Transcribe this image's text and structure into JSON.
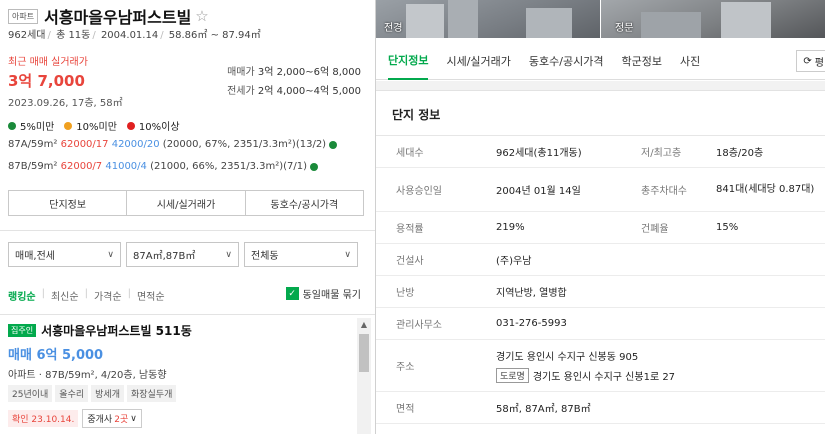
{
  "complex": {
    "type_badge": "아파트",
    "name": "서흥마을우남퍼스트빌",
    "star": "☆",
    "households": "962세대",
    "buildings": "총 11동",
    "approval": "2004.01.14",
    "area_range": "58.86㎡ ~ 87.94㎡"
  },
  "recent": {
    "label": "최근 매매 실거래가",
    "price": "3억 7,000",
    "meta": "2023.09.26, 17층, 58㎡"
  },
  "ranges": {
    "sale_label": "매매가",
    "sale_value": "3억 2,000~6억 8,000",
    "jeonse_label": "전세가",
    "jeonse_value": "2억 4,000~4억 5,000"
  },
  "legend": [
    {
      "label": "5%미만",
      "color": "#1a8a3a"
    },
    {
      "label": "10%미만",
      "color": "#f0a020"
    },
    {
      "label": "10%이상",
      "color": "#e02020"
    }
  ],
  "area_rows": [
    {
      "type": "87A/59m²",
      "sale": "62000/17",
      "jeonse": "42000/20",
      "detail": "(20000, 67%, 2351/3.3m²)(13/2)",
      "dot_color": "#1a8a3a"
    },
    {
      "type": "87B/59m²",
      "sale": "62000/7",
      "jeonse": "41000/4",
      "detail": "(21000, 66%, 2351/3.3m²)(7/1)",
      "dot_color": "#1a8a3a"
    }
  ],
  "buttons": [
    "단지정보",
    "시세/실거래가",
    "동호수/공시가격"
  ],
  "filters": [
    "매매,전세",
    "87A㎡,87B㎡",
    "전체동"
  ],
  "sort": {
    "options": [
      "랭킹순",
      "최신순",
      "가격순",
      "면적순"
    ],
    "same_listing": "동일매물 묶기"
  },
  "listing": {
    "badge": "집주인",
    "name": "서흥마을우남퍼스트빌 511동",
    "price": "매매 6억 5,000",
    "desc": "아파트 · 87B/59m², 4/20층, 남동향",
    "tags": [
      "25년이내",
      "올수리",
      "방세개",
      "화장실두개"
    ],
    "confirm": "확인 23.10.14.",
    "agent_prefix": "중개사",
    "agent_count": "2곳"
  },
  "photos": [
    "전경",
    "정문"
  ],
  "tabs": [
    "단지정보",
    "시세/실거래가",
    "동호수/공시가격",
    "학군정보",
    "사진"
  ],
  "tab_more": "평",
  "section_title": "단지 정보",
  "info": {
    "households_label": "세대수",
    "households_value": "962세대(총11개동)",
    "floors_label": "저/최고층",
    "floors_value": "18층/20층",
    "approval_label": "사용승인일",
    "approval_value": "2004년 01월 14일",
    "parking_label": "총주차대수",
    "parking_value": "841대(세대당 0.87대)",
    "far_label": "용적률",
    "far_value": "219%",
    "bcr_label": "건폐율",
    "bcr_value": "15%",
    "builder_label": "건설사",
    "builder_value": "(주)우남",
    "heating_label": "난방",
    "heating_value": "지역난방, 열병합",
    "office_label": "관리사무소",
    "office_value": "031-276-5993",
    "address_label": "주소",
    "address_value": "경기도 용인시 수지구 신봉동 905",
    "road_badge": "도로명",
    "road_value": "경기도 용인시 수지구 신봉1로 27",
    "area_label": "면적",
    "area_value": "58㎡, 87A㎡, 87B㎡"
  }
}
